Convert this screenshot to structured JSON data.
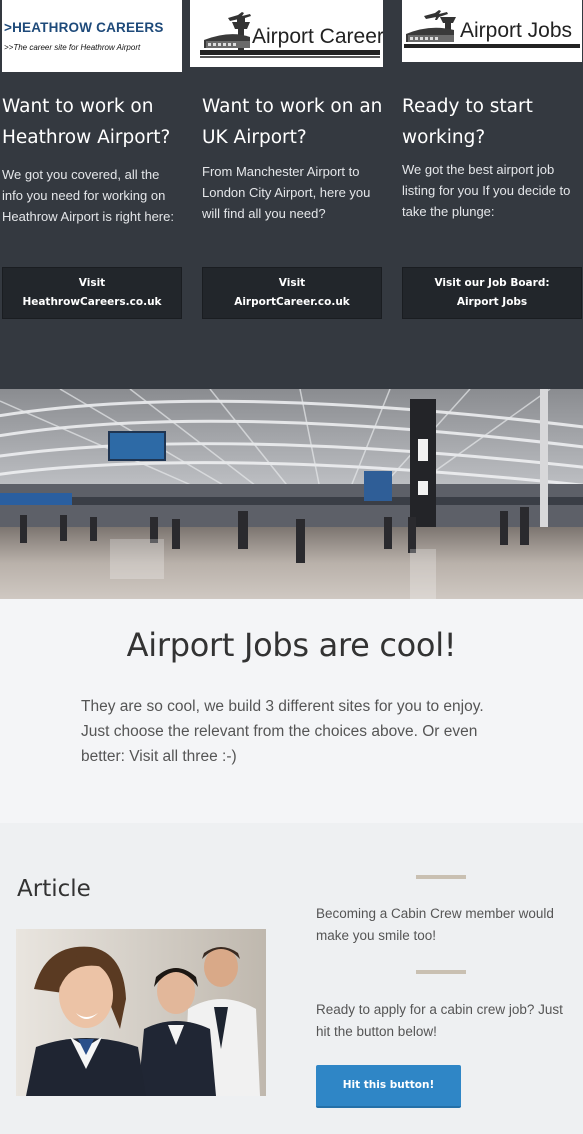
{
  "columns": [
    {
      "logo": {
        "title": ">HEATHROW CAREERS",
        "subtitle": ">>The career site for Heathrow Airport"
      },
      "heading": "Want to work on Heathrow Airport?",
      "text": "We got you covered, all the info you need for working on Heathrow Airport is right here:",
      "button": {
        "line1": "Visit",
        "line2": "HeathrowCareers.co.uk"
      }
    },
    {
      "logo": {
        "title": "Airport Career"
      },
      "heading": "Want to work on an UK Airport?",
      "text": "From Manchester Airport to London City Airport, here you will find all you need?",
      "button": {
        "line1": "Visit",
        "line2": "AirportCareer.co.uk"
      }
    },
    {
      "logo": {
        "title": "Airport Jobs"
      },
      "heading": "Ready to start working?",
      "text": "We got the best airport job listing for you If you decide to take the plunge:",
      "button": {
        "line1": "Visit our Job Board:",
        "line2": "Airport Jobs"
      }
    }
  ],
  "cool": {
    "title": "Airport Jobs are cool!",
    "text": "They are so cool, we build 3 different sites for you to enjoy. Just choose the relevant from the choices above. Or even better: Visit all three :-)"
  },
  "article": {
    "title": "Article",
    "text1": "Becoming a Cabin Crew member would make you smile too!",
    "text2": "Ready to apply for a cabin crew job? Just hit the button below!",
    "button_label": "Hit this button!"
  },
  "colors": {
    "dark_band": "#343940",
    "button_dark": "#22262b",
    "button_blue": "#2f86c6",
    "logo_blue": "#1e4a7a"
  }
}
